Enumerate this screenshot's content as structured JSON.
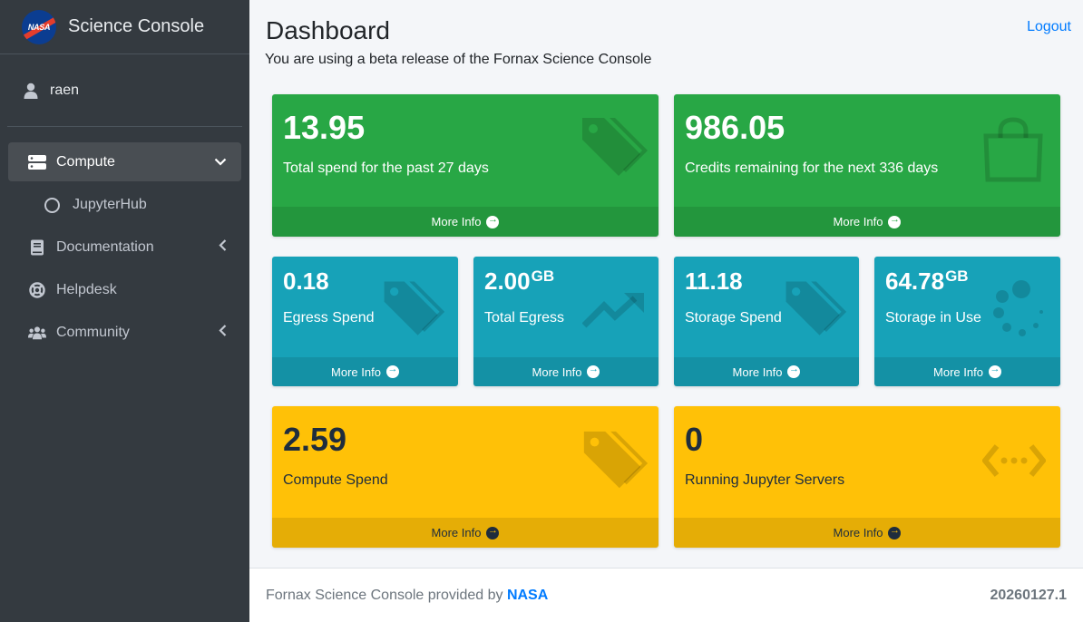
{
  "brand": {
    "logo_text": "NASA",
    "title": "Science Console"
  },
  "user": {
    "name": "raen"
  },
  "nav": {
    "compute": "Compute",
    "jupyterhub": "JupyterHub",
    "documentation": "Documentation",
    "helpdesk": "Helpdesk",
    "community": "Community"
  },
  "header": {
    "title": "Dashboard",
    "subtitle": "You are using a beta release of the Fornax Science Console",
    "logout": "Logout"
  },
  "cards": {
    "total_spend": {
      "value": "13.95",
      "label": "Total spend for the past 27 days",
      "more": "More Info"
    },
    "credits": {
      "value": "986.05",
      "label": "Credits remaining for the next 336 days",
      "more": "More Info"
    },
    "egress_spend": {
      "value": "0.18",
      "label": "Egress Spend",
      "more": "More Info"
    },
    "total_egress": {
      "value": "2.00",
      "unit": "GB",
      "label": "Total Egress",
      "more": "More Info"
    },
    "storage_spend": {
      "value": "11.18",
      "label": "Storage Spend",
      "more": "More Info"
    },
    "storage_use": {
      "value": "64.78",
      "unit": "GB",
      "label": "Storage in Use",
      "more": "More Info"
    },
    "compute_spend": {
      "value": "2.59",
      "label": "Compute Spend",
      "more": "More Info"
    },
    "jupyter_servers": {
      "value": "0",
      "label": "Running Jupyter Servers",
      "more": "More Info"
    }
  },
  "footer": {
    "text": "Fornax Science Console provided by",
    "link": "NASA",
    "version": "20260127.1"
  },
  "colors": {
    "green": "#28a745",
    "teal": "#17a2b8",
    "yellow": "#ffc107",
    "sidebar": "#343a40",
    "link": "#007bff"
  }
}
